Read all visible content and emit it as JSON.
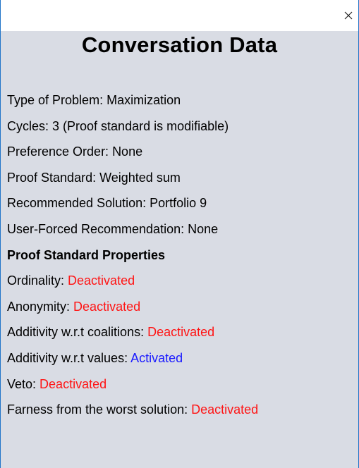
{
  "window": {
    "close_icon": "close-icon"
  },
  "heading": "Conversation Data",
  "info": [
    {
      "label": "Type of Problem: ",
      "value": "Maximization"
    },
    {
      "label": "Cycles: ",
      "value": "3 (Proof standard is modifiable)"
    },
    {
      "label": "Preference Order: ",
      "value": "None"
    },
    {
      "label": "Proof Standard: ",
      "value": "Weighted sum"
    },
    {
      "label": "Recommended Solution: ",
      "value": "Portfolio 9"
    },
    {
      "label": "User-Forced Recommendation: ",
      "value": "None"
    }
  ],
  "properties_heading": "Proof Standard Properties",
  "properties": [
    {
      "label": "Ordinality: ",
      "value": "Deactivated"
    },
    {
      "label": "Anonymity: ",
      "value": "Deactivated"
    },
    {
      "label": "Additivity w.r.t coalitions: ",
      "value": "Deactivated"
    },
    {
      "label": "Additivity w.r.t values: ",
      "value": "Activated"
    },
    {
      "label": "Veto: ",
      "value": "Deactivated"
    },
    {
      "label": "Farness from the worst solution: ",
      "value": "Deactivated"
    }
  ],
  "colors": {
    "deactivated": "#ff1414",
    "activated": "#1a1aff",
    "panel_background": "#d9dce4"
  }
}
